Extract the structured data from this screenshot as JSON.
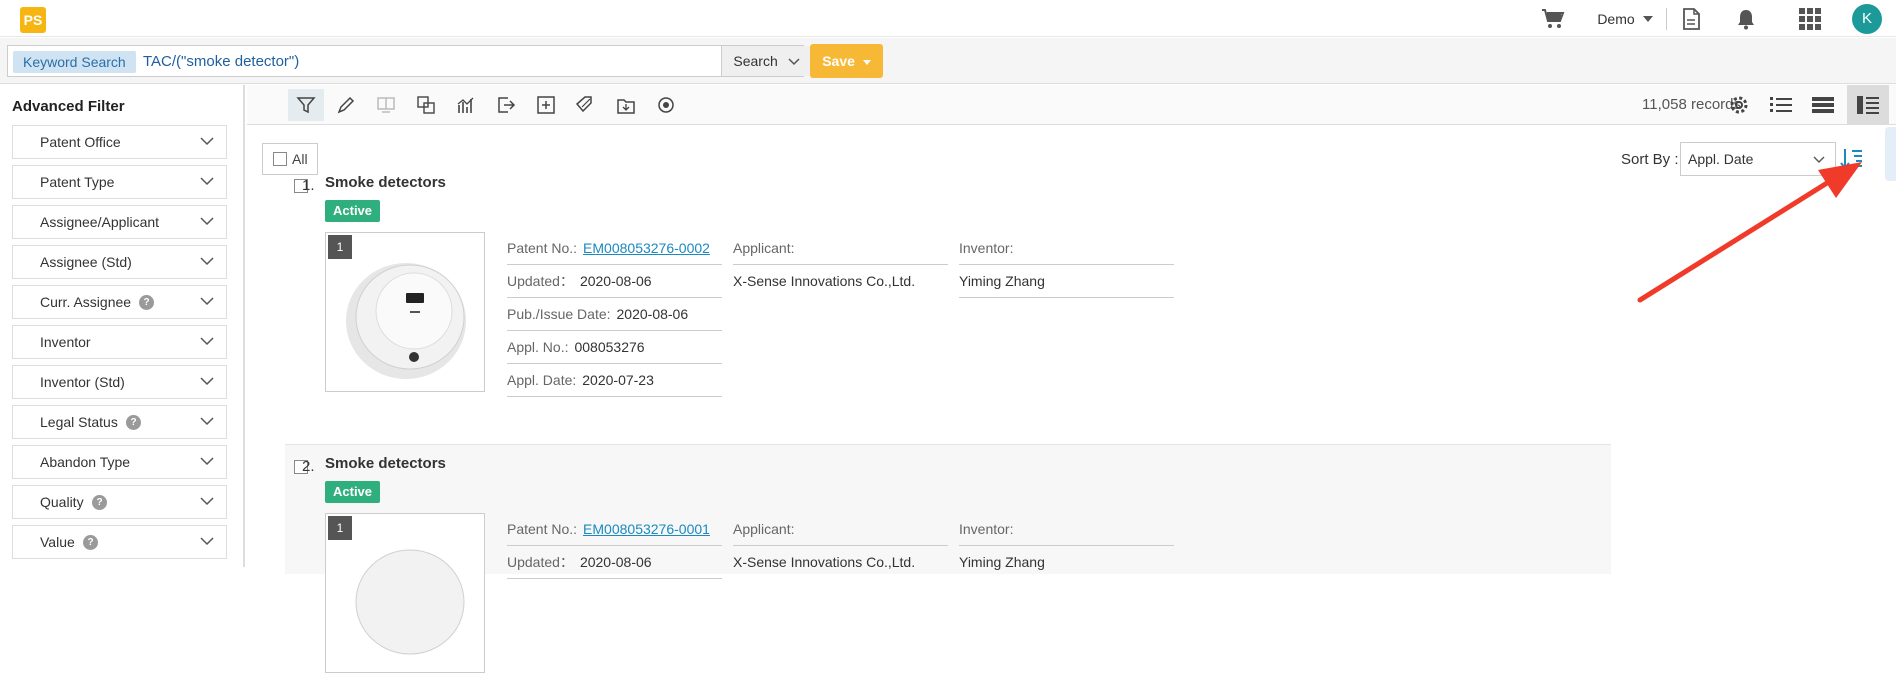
{
  "app": {
    "logo_text": "PS"
  },
  "header": {
    "user_menu_label": "Demo",
    "avatar_initial": "K"
  },
  "search": {
    "tag": "Keyword Search",
    "query": "TAC/(\"smoke detector\")",
    "search_button": "Search",
    "save_button": "Save"
  },
  "sidebar": {
    "title": "Advanced Filter",
    "filters": [
      {
        "label": "Patent Office",
        "help": false
      },
      {
        "label": "Patent Type",
        "help": false
      },
      {
        "label": "Assignee/Applicant",
        "help": false
      },
      {
        "label": "Assignee (Std)",
        "help": false
      },
      {
        "label": "Curr. Assignee",
        "help": true
      },
      {
        "label": "Inventor",
        "help": false
      },
      {
        "label": "Inventor (Std)",
        "help": false
      },
      {
        "label": "Legal Status",
        "help": true
      },
      {
        "label": "Abandon Type",
        "help": false
      },
      {
        "label": "Quality",
        "help": true
      },
      {
        "label": "Value",
        "help": true
      }
    ],
    "help_glyph": "?"
  },
  "toolbar": {
    "record_count": "11,058 records",
    "icons": [
      "filter-icon",
      "highlight-pen-icon",
      "compare-icon",
      "translate-icon",
      "analytics-chart-icon",
      "export-icon",
      "add-icon",
      "tag-icon",
      "folder-save-icon",
      "monitor-icon",
      "settings-icon",
      "list-view-icon",
      "compact-view-icon",
      "detail-view-icon"
    ]
  },
  "list": {
    "select_all_label": "All",
    "sort_by_label": "Sort By :",
    "sort_by_value": "Appl. Date"
  },
  "results": [
    {
      "index": "1.",
      "title": "Smoke detectors",
      "status": "Active",
      "image_count": "1",
      "patent_no_label": "Patent No.:",
      "patent_no": "EM008053276-0002",
      "updated_label": "Updated：",
      "updated": "2020-08-06",
      "pub_date_label": "Pub./Issue Date:",
      "pub_date": "2020-08-06",
      "appl_no_label": "Appl. No.:",
      "appl_no": "008053276",
      "appl_date_label": "Appl. Date:",
      "appl_date": "2020-07-23",
      "applicant_label": "Applicant:",
      "applicant": "X-Sense Innovations Co.,Ltd.",
      "inventor_label": "Inventor:",
      "inventor": "Yiming Zhang"
    },
    {
      "index": "2.",
      "title": "Smoke detectors",
      "status": "Active",
      "image_count": "1",
      "patent_no_label": "Patent No.:",
      "patent_no": "EM008053276-0001",
      "updated_label": "Updated：",
      "updated": "2020-08-06",
      "applicant_label": "Applicant:",
      "applicant": "X-Sense Innovations Co.,Ltd.",
      "inventor_label": "Inventor:",
      "inventor": "Yiming Zhang"
    }
  ],
  "colors": {
    "brand": "#f7b512",
    "save": "#f7b935",
    "active_badge": "#2fae7e",
    "link": "#1a8abf",
    "annotation_arrow": "#f03a2a"
  }
}
